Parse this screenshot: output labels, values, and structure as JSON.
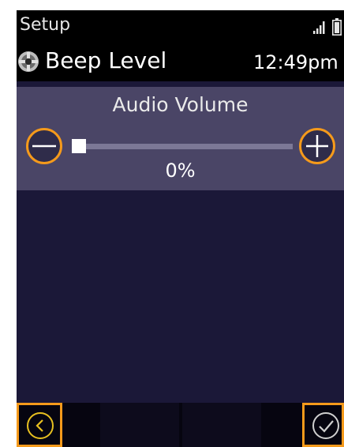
{
  "status_bar": {
    "app_title": "Setup",
    "signal_icon": "signal-bars-icon",
    "battery_icon": "battery-icon"
  },
  "header": {
    "icon": "settings-gear-icon",
    "title": "Beep Level",
    "time": "12:49pm"
  },
  "volume_control": {
    "label": "Audio Volume",
    "value_text": "0%",
    "level_percent": 0,
    "decrease_icon": "minus-icon",
    "increase_icon": "plus-icon"
  },
  "softkeys": {
    "back_icon": "chevron-left-icon",
    "confirm_icon": "checkmark-icon"
  },
  "colors": {
    "background": "#1b1838",
    "panel": "#4a4566",
    "accent": "#f59a1b",
    "back_icon": "#e8c020",
    "text": "#ffffff"
  }
}
